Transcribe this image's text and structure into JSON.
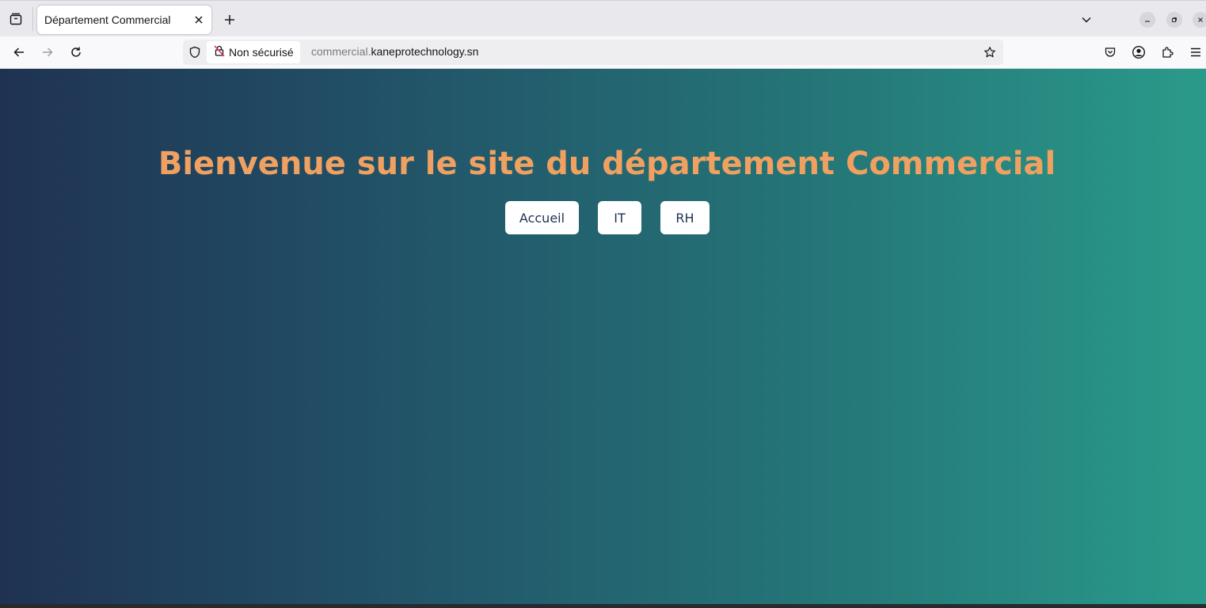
{
  "browser": {
    "tab": {
      "title": "Département Commercial"
    },
    "security_label": "Non sécurisé",
    "url": {
      "subdomain": "commercial.",
      "host": "kaneprotechnology.sn"
    }
  },
  "page": {
    "heading": "Bienvenue sur le site du département Commercial",
    "nav": [
      {
        "label": "Accueil"
      },
      {
        "label": "IT"
      },
      {
        "label": "RH"
      }
    ]
  },
  "colors": {
    "gradient_start": "#1f3252",
    "gradient_end": "#2a9a8b",
    "heading": "#f0a060",
    "button_bg": "#ffffff",
    "button_text": "#1f3252"
  }
}
